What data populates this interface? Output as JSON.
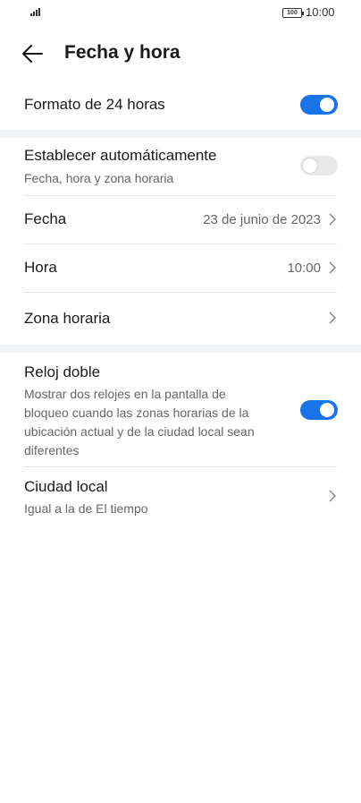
{
  "status_bar": {
    "battery": "100",
    "time": "10:00"
  },
  "header": {
    "title": "Fecha y hora"
  },
  "settings": {
    "format24": {
      "label": "Formato de 24 horas",
      "enabled": true
    },
    "auto": {
      "label": "Establecer automáticamente",
      "sub": "Fecha, hora y zona horaria",
      "enabled": false
    },
    "date": {
      "label": "Fecha",
      "value": "23 de junio de 2023"
    },
    "time": {
      "label": "Hora",
      "value": "10:00"
    },
    "timezone": {
      "label": "Zona horaria"
    },
    "dual_clock": {
      "label": "Reloj doble",
      "sub_lines": [
        "Mostrar dos relojes en la pantalla de",
        "bloqueo cuando las zonas horarias de la",
        "ubicación actual y de la ciudad local sean",
        "diferentes"
      ],
      "enabled": true
    },
    "home_city": {
      "label": "Ciudad local",
      "sub": "Igual a la de El tiempo"
    }
  },
  "colors": {
    "accent": "#1a73e8",
    "toggle_off": "#e9e9ea",
    "band": "#f1f3f5"
  }
}
